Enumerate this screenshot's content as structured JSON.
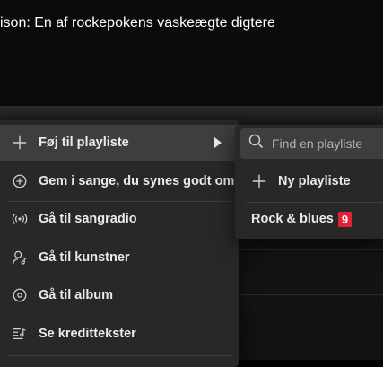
{
  "header": {
    "title": "ison: En af rockepokens vaskeægte digtere"
  },
  "context_menu": {
    "items": [
      {
        "label": "Føj til playliste",
        "icon": "plus-icon",
        "has_submenu": true
      },
      {
        "label": "Gem i sange, du synes godt om",
        "icon": "add-circle-icon"
      },
      {
        "label": "Gå til sangradio",
        "icon": "radio-icon"
      },
      {
        "label": "Gå til kunstner",
        "icon": "artist-icon"
      },
      {
        "label": "Gå til album",
        "icon": "album-icon"
      },
      {
        "label": "Se kredittekster",
        "icon": "credits-icon"
      }
    ]
  },
  "submenu": {
    "search_placeholder": "Find en playliste",
    "new_playlist_label": "Ny playliste",
    "playlist_label": "Rock & blues",
    "playlist_badge": "9"
  },
  "colors": {
    "menu_bg": "#282828",
    "highlight_bg": "#3e3e3e",
    "badge": "#e22134"
  }
}
